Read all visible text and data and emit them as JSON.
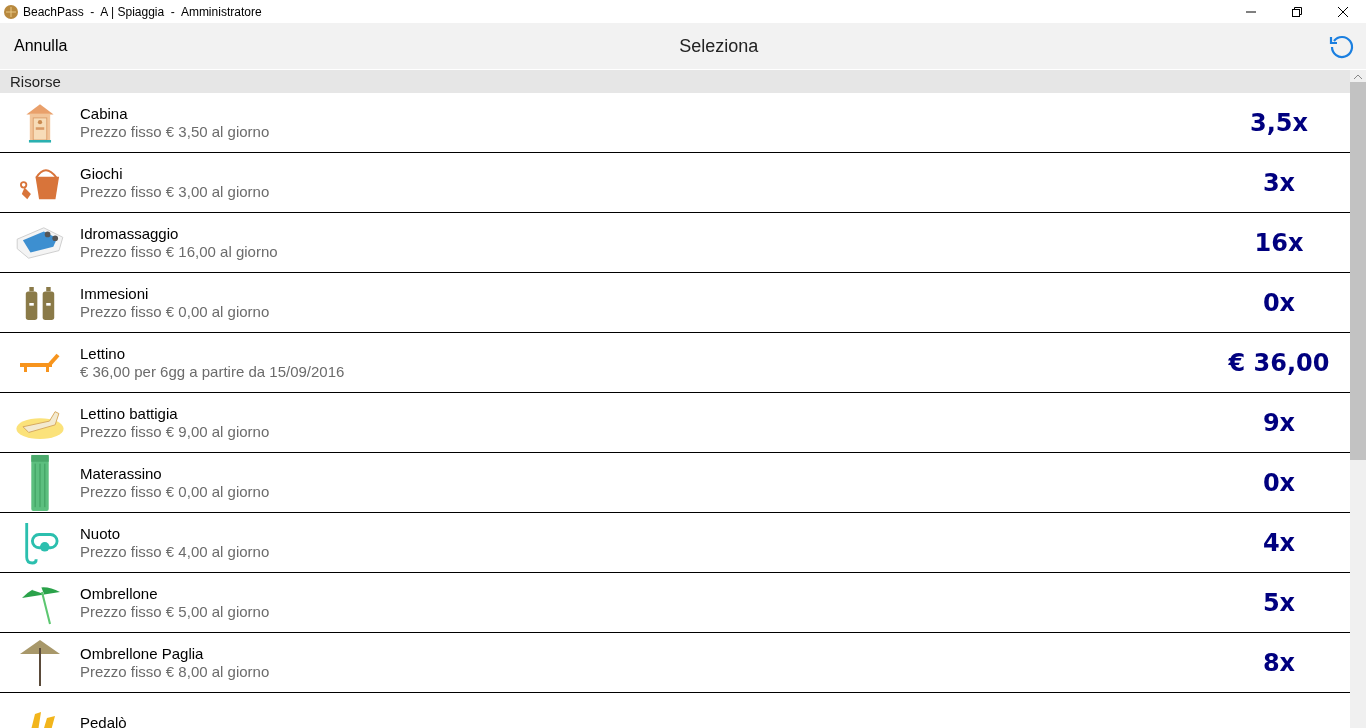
{
  "window": {
    "title": "BeachPass  -  A | Spiaggia  -  Amministratore"
  },
  "header": {
    "cancel": "Annulla",
    "title": "Seleziona"
  },
  "section": "Risorse",
  "rows": [
    {
      "kind": "cabin",
      "name": "Cabina",
      "detail": "Prezzo fisso € 3,50 al giorno",
      "count": "3,5x"
    },
    {
      "kind": "bucket",
      "name": "Giochi",
      "detail": "Prezzo fisso € 3,00 al giorno",
      "count": "3x"
    },
    {
      "kind": "tub",
      "name": "Idromassaggio",
      "detail": "Prezzo fisso € 16,00 al giorno",
      "count": "16x"
    },
    {
      "kind": "bottles",
      "name": "Immesioni",
      "detail": "Prezzo fisso € 0,00 al giorno",
      "count": "0x"
    },
    {
      "kind": "lounger",
      "name": "Lettino",
      "detail": "€ 36,00 per 6gg a partire da 15/09/2016",
      "count": "€ 36,00"
    },
    {
      "kind": "sandbed",
      "name": "Lettino battigia",
      "detail": "Prezzo fisso € 9,00 al giorno",
      "count": "9x"
    },
    {
      "kind": "mattress",
      "name": "Materassino",
      "detail": "Prezzo fisso € 0,00 al giorno",
      "count": "0x"
    },
    {
      "kind": "snorkel",
      "name": "Nuoto",
      "detail": "Prezzo fisso € 4,00 al giorno",
      "count": "4x"
    },
    {
      "kind": "umbrella",
      "name": "Ombrellone",
      "detail": "Prezzo fisso € 5,00 al giorno",
      "count": "5x"
    },
    {
      "kind": "straw",
      "name": "Ombrellone Paglia",
      "detail": "Prezzo fisso € 8,00 al giorno",
      "count": "8x"
    },
    {
      "kind": "pedalo",
      "name": "Pedalò"
    }
  ]
}
